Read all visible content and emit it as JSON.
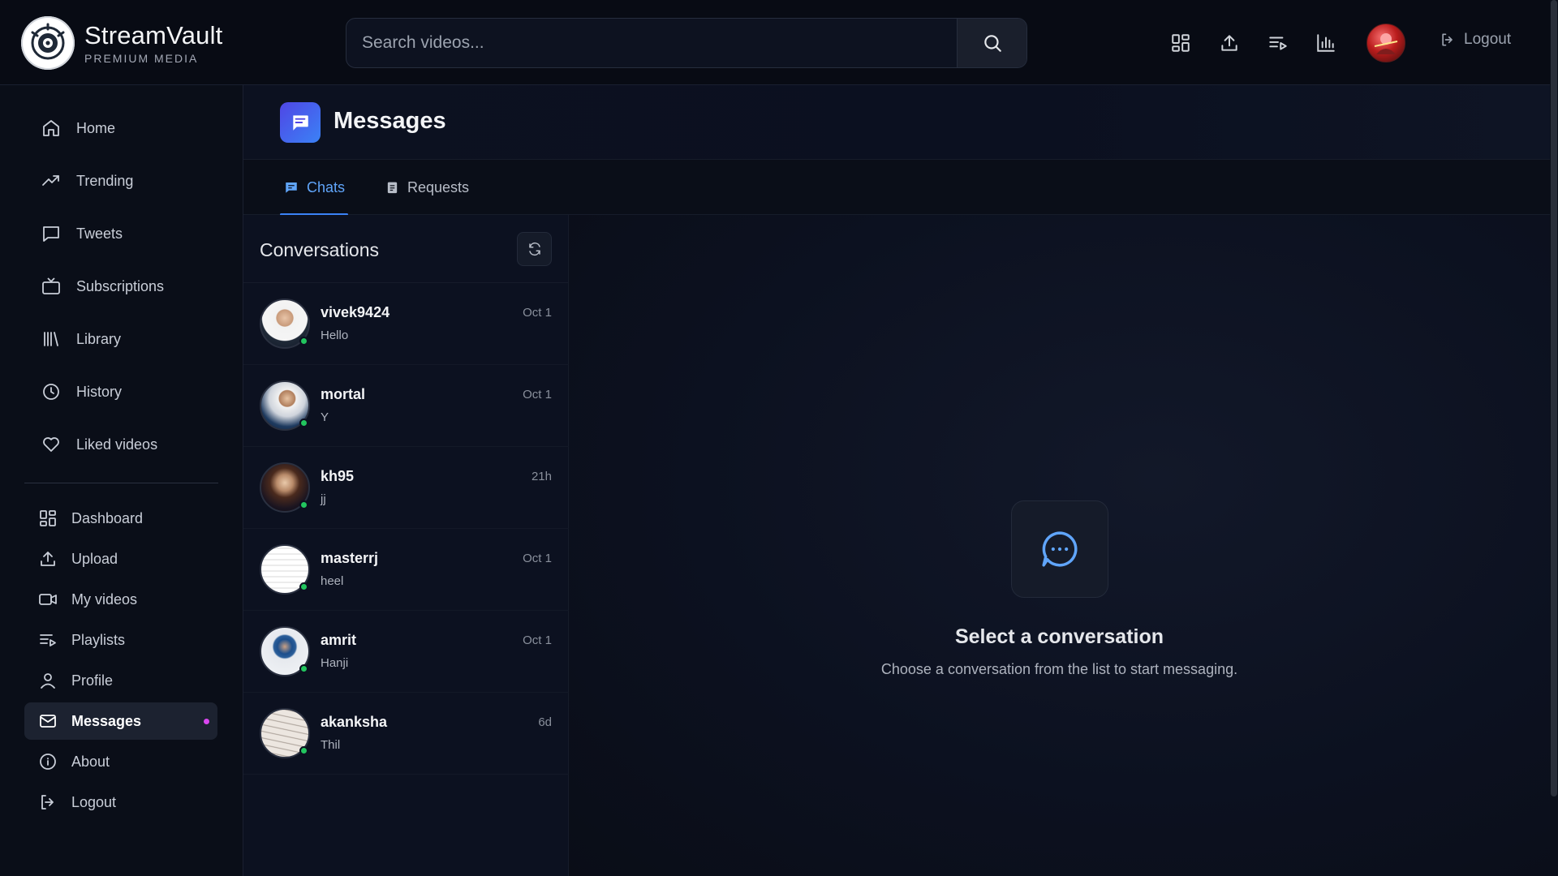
{
  "brand": {
    "name": "StreamVault",
    "subtitle": "PREMIUM MEDIA"
  },
  "search": {
    "placeholder": "Search videos..."
  },
  "top_icons": [
    "dashboard-icon",
    "upload-icon",
    "playlist-icon",
    "stats-icon"
  ],
  "top_logout": "Logout",
  "sidebar": {
    "primary": [
      {
        "label": "Home",
        "icon": "home-icon"
      },
      {
        "label": "Trending",
        "icon": "trending-icon"
      },
      {
        "label": "Tweets",
        "icon": "chat-bubble-icon"
      },
      {
        "label": "Subscriptions",
        "icon": "tv-icon"
      },
      {
        "label": "Library",
        "icon": "library-icon"
      },
      {
        "label": "History",
        "icon": "clock-icon"
      },
      {
        "label": "Liked videos",
        "icon": "heart-icon"
      }
    ],
    "secondary": [
      {
        "label": "Dashboard",
        "icon": "dashboard-icon"
      },
      {
        "label": "Upload",
        "icon": "upload-icon"
      },
      {
        "label": "My videos",
        "icon": "video-icon"
      },
      {
        "label": "Playlists",
        "icon": "playlist-icon"
      },
      {
        "label": "Profile",
        "icon": "user-icon"
      },
      {
        "label": "Messages",
        "icon": "mail-icon",
        "active": true
      },
      {
        "label": "About",
        "icon": "info-icon"
      },
      {
        "label": "Logout",
        "icon": "logout-icon"
      }
    ]
  },
  "page": {
    "title": "Messages"
  },
  "tabs": [
    {
      "label": "Chats",
      "active": true
    },
    {
      "label": "Requests",
      "active": false
    }
  ],
  "conversations": {
    "title": "Conversations",
    "items": [
      {
        "name": "vivek9424",
        "message": "Hello",
        "time": "Oct 1"
      },
      {
        "name": "mortal",
        "message": "Y",
        "time": "Oct 1"
      },
      {
        "name": "kh95",
        "message": "jj",
        "time": "21h"
      },
      {
        "name": "masterrj",
        "message": "heel",
        "time": "Oct 1"
      },
      {
        "name": "amrit",
        "message": "Hanji",
        "time": "Oct 1"
      },
      {
        "name": "akanksha",
        "message": "Thil",
        "time": "6d"
      }
    ]
  },
  "empty_state": {
    "title": "Select a conversation",
    "subtitle": "Choose a conversation from the list to start messaging."
  },
  "colors": {
    "accent": "#3b82f6",
    "online": "#22c55e",
    "notification_dot": "#d946ef"
  }
}
